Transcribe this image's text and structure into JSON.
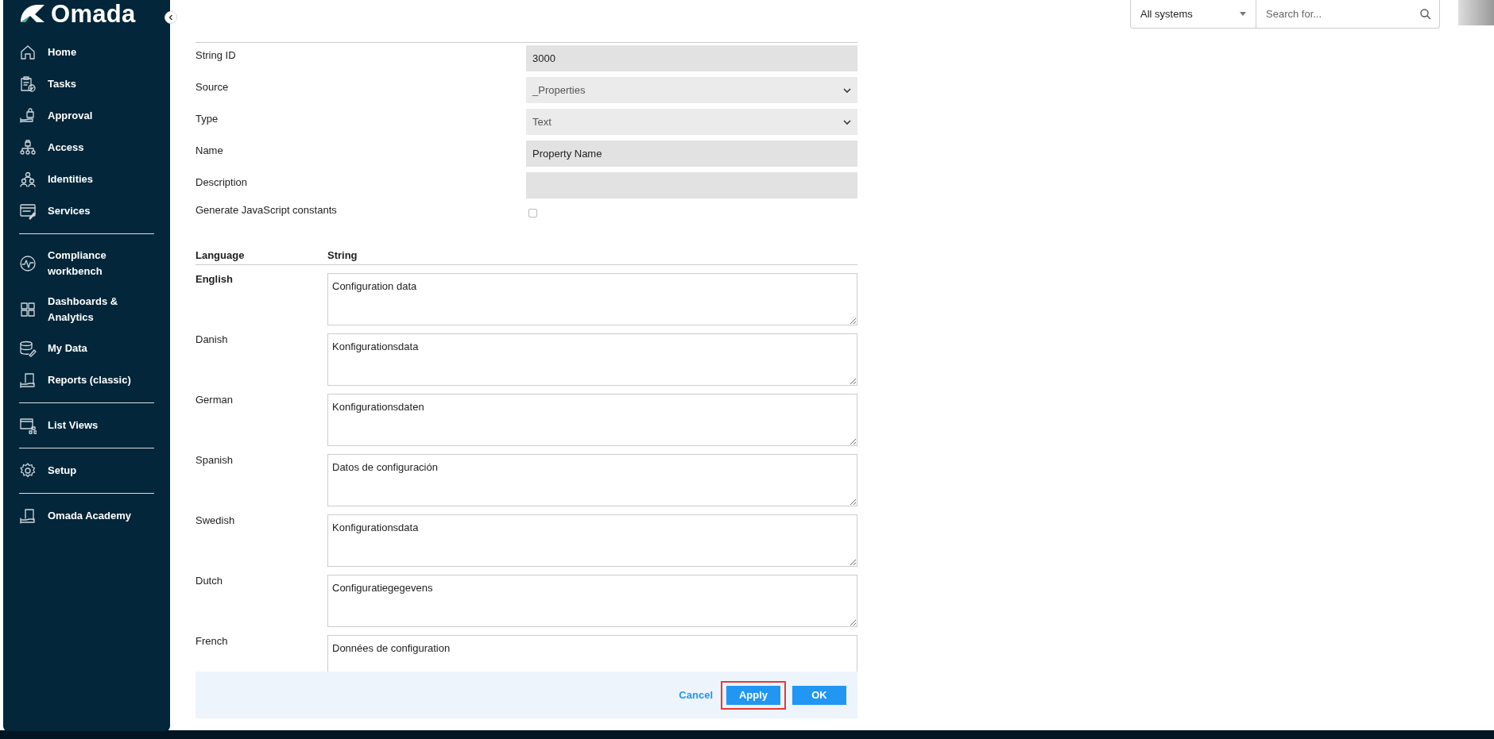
{
  "sidebar": {
    "logo": "Omada",
    "groups": [
      [
        {
          "label": "Home",
          "selected": false
        },
        {
          "label": "Tasks",
          "selected": false
        },
        {
          "label": "Approval",
          "selected": false
        },
        {
          "label": "Access",
          "selected": false
        },
        {
          "label": "Identities",
          "selected": false
        },
        {
          "label": "Services",
          "selected": false
        }
      ],
      [
        {
          "label": "Compliance workbench",
          "selected": false
        },
        {
          "label": "Dashboards & Analytics",
          "selected": false
        },
        {
          "label": "My Data",
          "selected": false
        },
        {
          "label": "Reports (classic)",
          "selected": false
        }
      ],
      [
        {
          "label": "List Views",
          "selected": false
        }
      ],
      [
        {
          "label": "Setup",
          "selected": false
        }
      ],
      [
        {
          "label": "Omada Academy",
          "selected": false
        }
      ]
    ]
  },
  "topbar": {
    "system_filter": "All systems",
    "search": {
      "placeholder": "Search for..."
    }
  },
  "form": {
    "fields": [
      {
        "kind": "text",
        "label": "String ID",
        "value": "3000"
      },
      {
        "kind": "select",
        "label": "Source",
        "value": "_Properties"
      },
      {
        "kind": "select",
        "label": "Type",
        "value": "Text"
      },
      {
        "kind": "text",
        "label": "Name",
        "value": "Property Name"
      },
      {
        "kind": "text",
        "label": "Description"
      },
      {
        "kind": "checkbox",
        "label": "Generate JavaScript constants",
        "checked": false
      }
    ]
  },
  "strings": {
    "columns": [
      "Language",
      "String"
    ],
    "rows": [
      {
        "language": "English",
        "primary": true,
        "string": "Configuration data"
      },
      {
        "language": "Danish",
        "primary": false,
        "string": "Konfigurationsdata"
      },
      {
        "language": "German",
        "primary": false,
        "string": "Konfigurationsdaten"
      },
      {
        "language": "Spanish",
        "primary": false,
        "string": "Datos de configuración"
      },
      {
        "language": "Swedish",
        "primary": false,
        "string": "Konfigurationsdata"
      },
      {
        "language": "Dutch",
        "primary": false,
        "string": "Configuratiegegevens"
      },
      {
        "language": "French",
        "primary": false,
        "string": "Données de configuration"
      }
    ]
  },
  "footer": {
    "buttons": [
      {
        "kind": "link",
        "label": "Cancel",
        "highlighted": false
      },
      {
        "kind": "primary",
        "label": "Apply",
        "highlighted": true
      },
      {
        "kind": "primary",
        "label": "OK",
        "highlighted": false
      }
    ]
  }
}
